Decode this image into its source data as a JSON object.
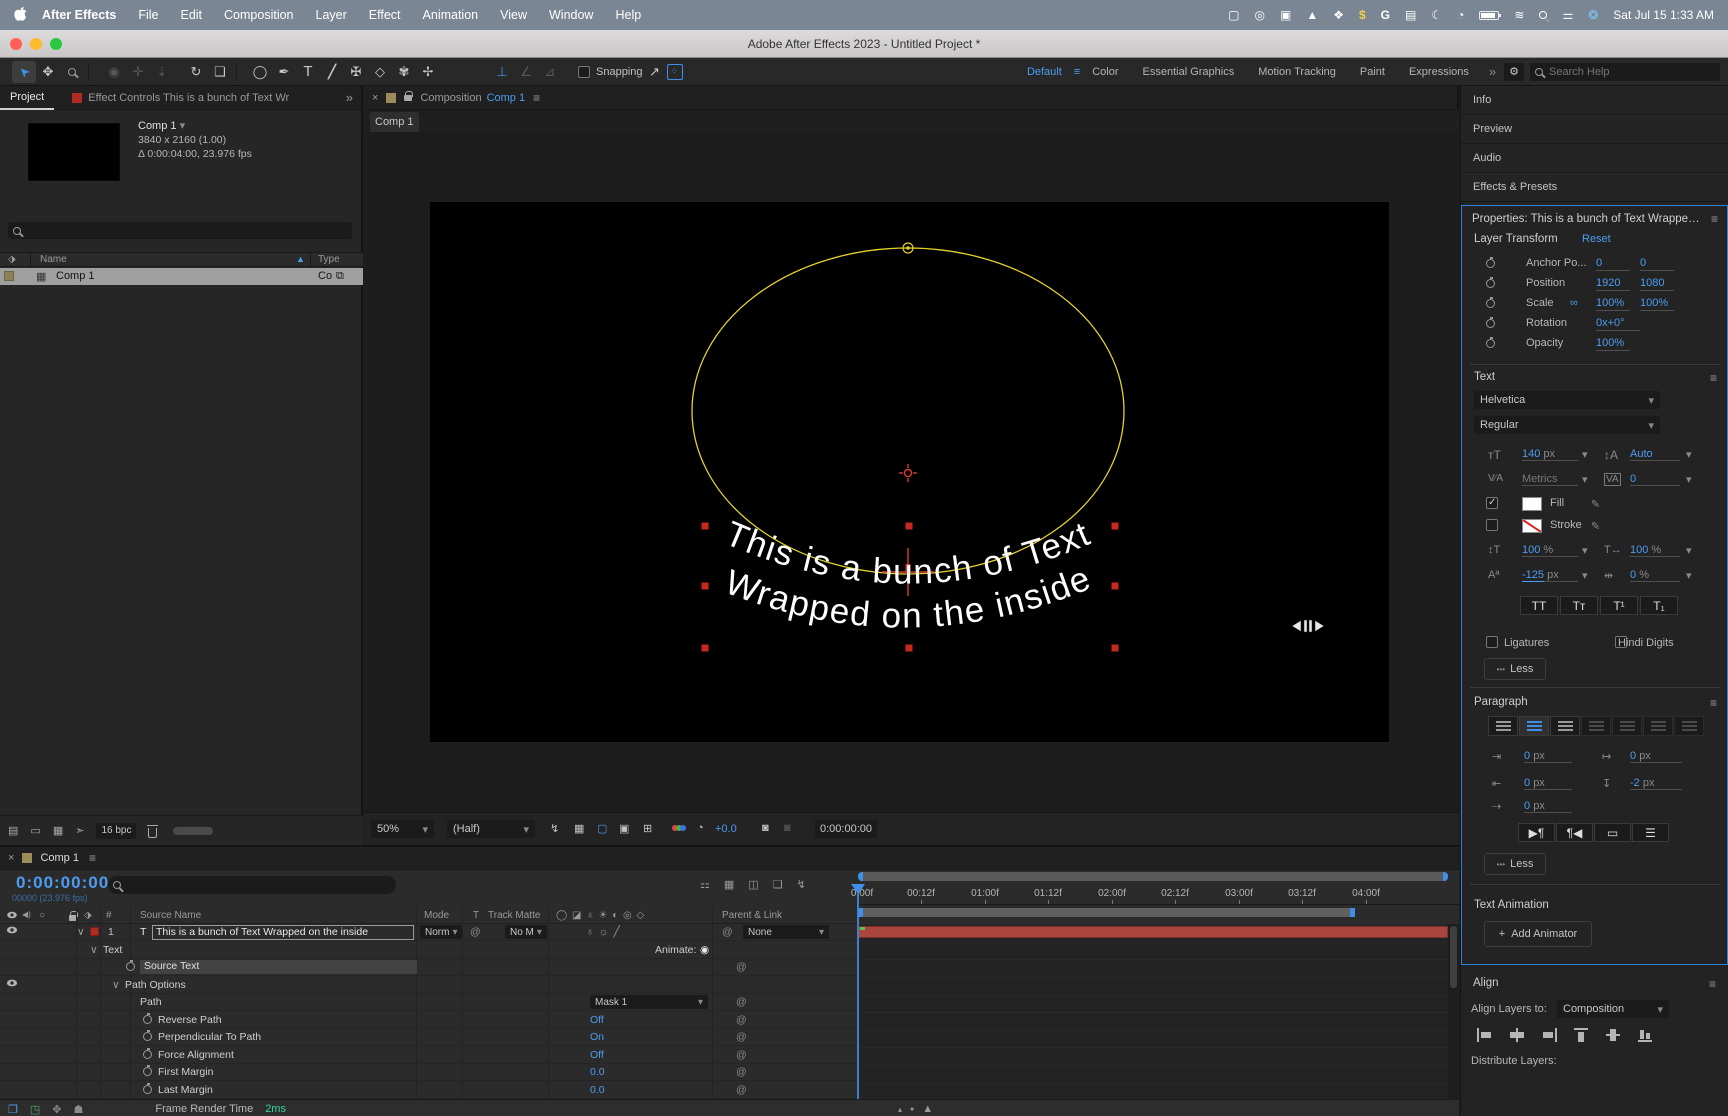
{
  "menubar": {
    "items": [
      "After Effects",
      "File",
      "Edit",
      "Composition",
      "Layer",
      "Effect",
      "Animation",
      "View",
      "Window",
      "Help"
    ],
    "clock": "Sat Jul 15  1:33 AM"
  },
  "titlebar": {
    "title": "Adobe After Effects 2023 - Untitled Project *"
  },
  "toolbar": {
    "snapping": "Snapping",
    "workspaces": [
      "Default",
      "Color",
      "Essential Graphics",
      "Motion Tracking",
      "Paint",
      "Expressions"
    ],
    "search_placeholder": "Search Help"
  },
  "project": {
    "tab": "Project",
    "effects_tab": "Effect Controls This is a bunch of Text Wr",
    "comp_name": "Comp 1",
    "comp_size": "3840 x 2160 (1.00)",
    "comp_duration": "Δ 0:00:04:00, 23.976 fps",
    "col_name": "Name",
    "col_type": "Type",
    "row_name": "Comp 1",
    "row_type": "Co",
    "bpc": "16 bpc"
  },
  "comp": {
    "panel_title": "Composition",
    "panel_comp": "Comp 1",
    "tab": "Comp 1",
    "zoom": "50%",
    "resolution": "(Half)",
    "exposure": "+0.0",
    "timecode": "0:00:00:00",
    "text_line1": "This is a bunch of Text",
    "text_line2": "Wrapped on the inside"
  },
  "right": {
    "panel_info": "Info",
    "panel_preview": "Preview",
    "panel_audio": "Audio",
    "panel_effects": "Effects & Presets",
    "properties_title": "Properties: This is a bunch of Text Wrapped o",
    "transform": {
      "header": "Layer Transform",
      "reset": "Reset",
      "anchor_label": "Anchor Po...",
      "anchor_x": "0",
      "anchor_y": "0",
      "position_label": "Position",
      "position_x": "1920",
      "position_y": "1080",
      "scale_label": "Scale",
      "scale_x": "100%",
      "scale_y": "100%",
      "rotation_label": "Rotation",
      "rotation": "0x+0°",
      "opacity_label": "Opacity",
      "opacity": "100%"
    },
    "text": {
      "header": "Text",
      "font": "Helvetica",
      "style": "Regular",
      "size": "140",
      "size_unit": "px",
      "leading": "Auto",
      "kerning": "Metrics",
      "tracking": "0",
      "fill": "Fill",
      "stroke": "Stroke",
      "vscale": "100",
      "vscale_unit": "%",
      "hscale": "100",
      "hscale_unit": "%",
      "baseline": "-125",
      "baseline_unit": "px",
      "tsume": "0",
      "tsume_unit": "%",
      "caps": [
        "TT",
        "Tᴛ",
        "T¹",
        "T₁"
      ],
      "ligatures": "Ligatures",
      "hindi": "Hindi Digits",
      "less": "Less"
    },
    "paragraph": {
      "header": "Paragraph",
      "indent_left": "0",
      "indent_left_unit": "px",
      "indent_right": "0",
      "indent_right_unit": "px",
      "space_before": "0",
      "space_before_unit": "px",
      "space_after": "-2",
      "space_after_unit": "px",
      "first_line": "0",
      "first_line_unit": "px",
      "less": "Less"
    },
    "text_animation": {
      "header": "Text Animation",
      "add": "Add Animator"
    },
    "align": {
      "header": "Align",
      "to_label": "Align Layers to:",
      "to_value": "Composition",
      "distribute_label": "Distribute Layers:"
    }
  },
  "timeline": {
    "tab": "Comp 1",
    "timecode": "0:00:00:00",
    "frames": "00000 (23.976 fps)",
    "col_source": "Source Name",
    "col_mode": "Mode",
    "col_t": "T",
    "col_matte": "Track Matte",
    "col_parent": "Parent & Link",
    "layer_num": "1",
    "layer_name": "This is a bunch of Text Wrapped on the inside",
    "mode": "Norm",
    "matte": "No M",
    "parent": "None",
    "group_text": "Text",
    "animate": "Animate:",
    "source_text": "Source Text",
    "path_options": "Path Options",
    "path_label": "Path",
    "path_value": "Mask 1",
    "rows": [
      {
        "label": "Reverse Path",
        "value": "Off"
      },
      {
        "label": "Perpendicular To Path",
        "value": "On"
      },
      {
        "label": "Force Alignment",
        "value": "Off"
      },
      {
        "label": "First Margin",
        "value": "0.0"
      },
      {
        "label": "Last Margin",
        "value": "0.0"
      }
    ],
    "ticks": [
      "0:00f",
      "00:12f",
      "01:00f",
      "01:12f",
      "02:00f",
      "02:12f",
      "03:00f",
      "03:12f",
      "04:00f"
    ],
    "status_label": "Frame Render Time",
    "status_value": "2ms"
  },
  "icons": {
    "hand": "✥",
    "orbit": "◉",
    "pancam": "✛",
    "dolly": "⇣",
    "rotate": "↻",
    "camera": "❏",
    "shape": "◯",
    "pen": "✒",
    "type": "T",
    "brush": "╱",
    "stamp": "✠",
    "eraser": "◇",
    "roto": "✾",
    "pin": "✢",
    "axis1": "⊥",
    "axis2": "∠",
    "axis3": "⊿",
    "snap_cursor": "↗",
    "snap_box": "⁘",
    "chev": "▾",
    "menu": "≡",
    "more": "»",
    "close": "×",
    "sortup": "▲",
    "whip": "@",
    "link": "∞",
    "animate": "◉",
    "collapse": "∨",
    "tag": "⬗",
    "flow": "⧉",
    "comp_item": "▦",
    "proj1": "▤",
    "proj2": "▭",
    "proj3": "▦",
    "proj4": "➣",
    "tlv1": "⚏",
    "tlv2": "▦",
    "tlv3": "◫",
    "tlv4": "❏",
    "tlv5": "↯",
    "fast": "↯",
    "grid": "▦",
    "mask": "▢",
    "roi": "▣",
    "cropc": "⊞",
    "exposure": "◔",
    "cam1": "◙",
    "cam2": "◙",
    "speaker": "◀)",
    "solo": "○",
    "switch_cluster": "♁ ☼ ╱",
    "header_switches": "◯ ◪ ♁ ☀ ◐ ◎ ◇",
    "st1": "❐",
    "st2": "◳",
    "st3": "✥",
    "st4": "☗",
    "zo": "▴",
    "zi": "▲",
    "zknob": "●",
    "dropper": "✐",
    "plus": "+",
    "bullets": "•••",
    "dir_ltr": "▶¶",
    "dir_rtl": "¶◀",
    "dir_underline": "▭",
    "dir_box": "☰",
    "mb1": "▢",
    "mb2": "◎",
    "mb3": "▣",
    "mb4": "▲",
    "mb5": "❖",
    "mb6": "$",
    "mb7": "G",
    "mb8": "▤",
    "mb9": "☾",
    "mb10": "◔",
    "mb11": "≋",
    "mb12": "⚌",
    "mb13": "❂"
  }
}
